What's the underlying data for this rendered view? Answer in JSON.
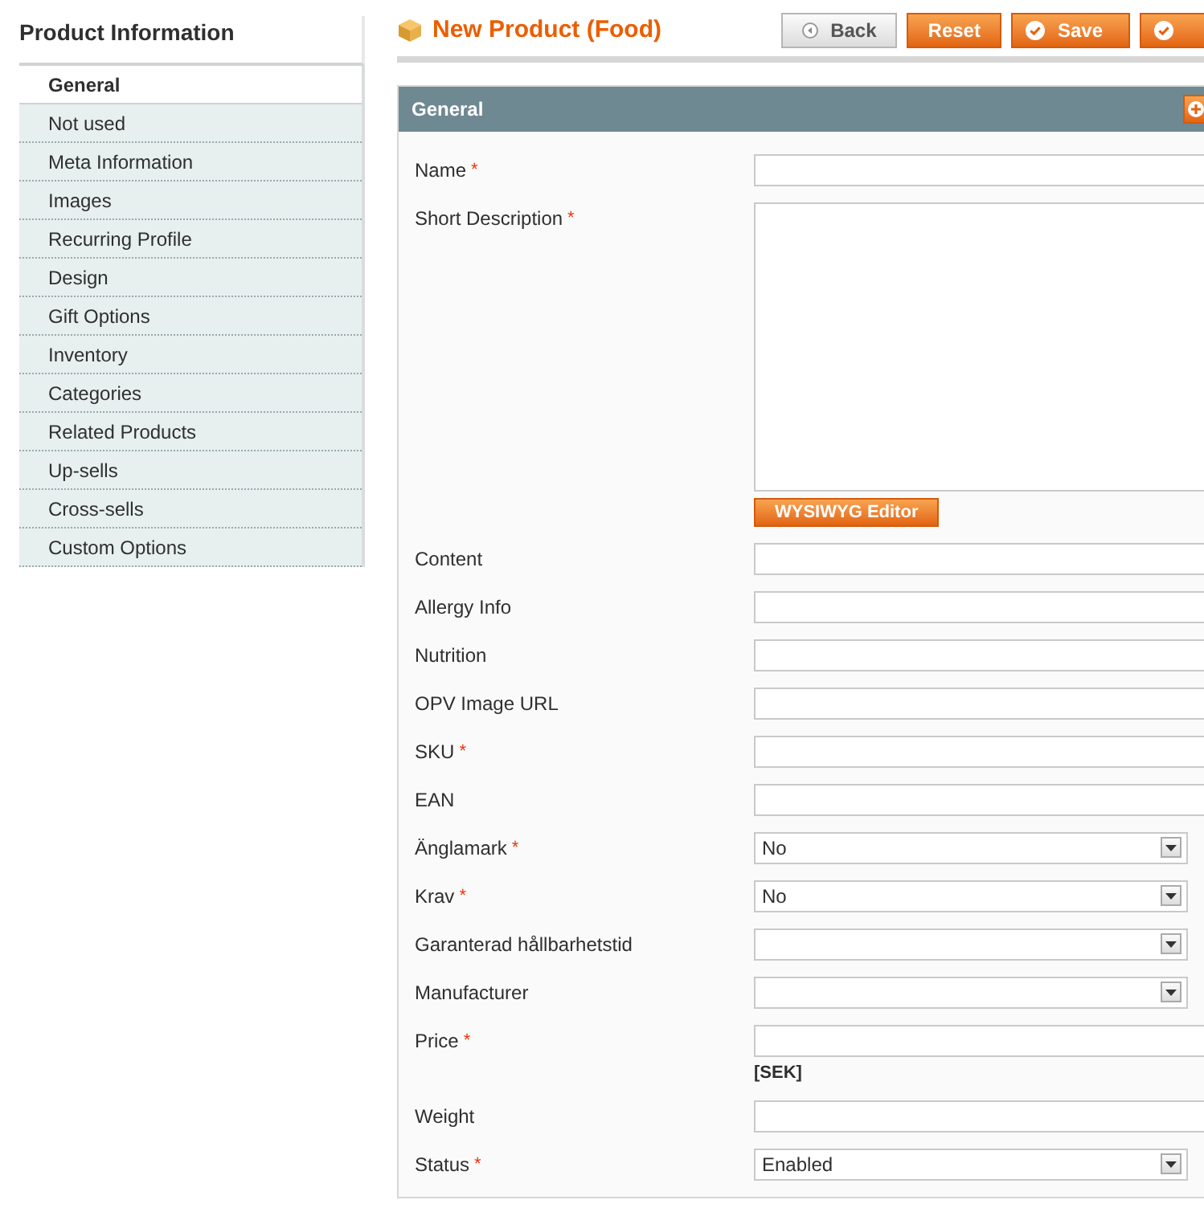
{
  "sidebar": {
    "title": "Product Information",
    "items": [
      {
        "label": "General",
        "selected": true
      },
      {
        "label": "Not used",
        "selected": false
      },
      {
        "label": "Meta Information",
        "selected": false
      },
      {
        "label": "Images",
        "selected": false
      },
      {
        "label": "Recurring Profile",
        "selected": false
      },
      {
        "label": "Design",
        "selected": false
      },
      {
        "label": "Gift Options",
        "selected": false
      },
      {
        "label": "Inventory",
        "selected": false
      },
      {
        "label": "Categories",
        "selected": false
      },
      {
        "label": "Related Products",
        "selected": false
      },
      {
        "label": "Up-sells",
        "selected": false
      },
      {
        "label": "Cross-sells",
        "selected": false
      },
      {
        "label": "Custom Options",
        "selected": false
      }
    ]
  },
  "header": {
    "title": "New Product (Food)",
    "buttons": [
      {
        "kind": "back",
        "label": "Back"
      },
      {
        "kind": "plain",
        "label": "Reset"
      },
      {
        "kind": "check",
        "label": "Save"
      },
      {
        "kind": "check"
      }
    ]
  },
  "section": {
    "title": "General",
    "fields": [
      {
        "kind": "text",
        "label": "Name",
        "required_mark": "*"
      },
      {
        "kind": "textarea",
        "label": "Short Description",
        "required_mark": "*",
        "button": "WYSIWYG Editor"
      },
      {
        "kind": "text",
        "label": "Content"
      },
      {
        "kind": "text",
        "label": "Allergy Info"
      },
      {
        "kind": "text",
        "label": "Nutrition"
      },
      {
        "kind": "text",
        "label": "OPV Image URL"
      },
      {
        "kind": "text",
        "label": "SKU",
        "required_mark": "*"
      },
      {
        "kind": "text",
        "label": "EAN"
      },
      {
        "kind": "select",
        "label": "Änglamark",
        "required_mark": "*",
        "value": "No"
      },
      {
        "kind": "select",
        "label": "Krav",
        "required_mark": "*",
        "value": "No"
      },
      {
        "kind": "select",
        "label": "Garanterad hållbarhetstid"
      },
      {
        "kind": "select",
        "label": "Manufacturer"
      },
      {
        "kind": "text",
        "label": "Price",
        "required_mark": "*",
        "note": "[SEK]"
      },
      {
        "kind": "text",
        "label": "Weight"
      },
      {
        "kind": "select",
        "label": "Status",
        "required_mark": "*",
        "value": "Enabled"
      }
    ]
  }
}
